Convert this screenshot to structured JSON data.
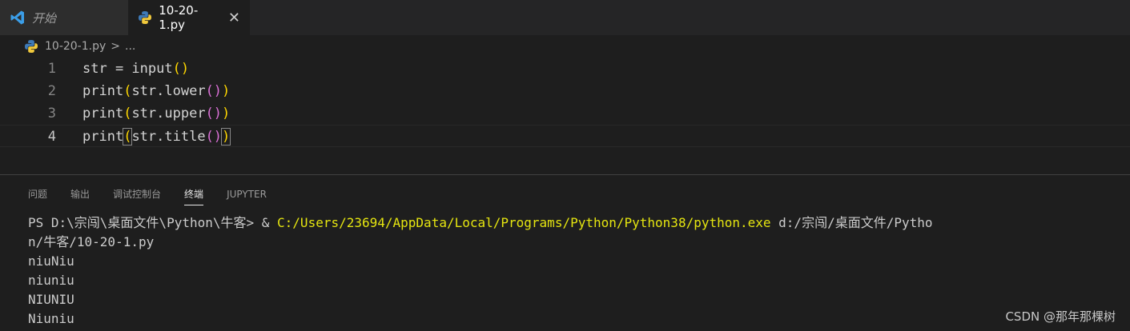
{
  "tabs": {
    "start_label": "开始",
    "file_label": "10-20-1.py",
    "close_glyph": "✕"
  },
  "breadcrumb": {
    "file": "10-20-1.py",
    "separator": ">",
    "more": "..."
  },
  "editor": {
    "lines": [
      {
        "num": "1",
        "a": "str = input",
        "o1": "(",
        "c1": ")"
      },
      {
        "num": "2",
        "a": "print",
        "o1": "(",
        "mid": "str.lower",
        "o2": "()",
        "c1": ")"
      },
      {
        "num": "3",
        "a": "print",
        "o1": "(",
        "mid": "str.upper",
        "o2": "()",
        "c1": ")"
      },
      {
        "num": "4",
        "a": "print",
        "o1": "(",
        "mid": "str.title",
        "o2": "()",
        "c1": ")"
      }
    ]
  },
  "panel": {
    "tabs": [
      "问题",
      "输出",
      "调试控制台",
      "终端",
      "JUPYTER"
    ],
    "active_tab": "终端"
  },
  "terminal": {
    "prompt": "PS D:\\宗闯\\桌面文件\\Python\\牛客> & ",
    "exe": "C:/Users/23694/AppData/Local/Programs/Python/Python38/python.exe",
    "arg1": " d:/宗闯/桌面文件/Pytho",
    "arg2": "n/牛客/10-20-1.py",
    "outputs": [
      "niuNiu",
      "niuniu",
      "NIUNIU",
      "Niuniu"
    ]
  },
  "watermark": "CSDN @那年那棵树",
  "colors": {
    "accent_yellow": "#ffd700",
    "accent_purple": "#da70d6",
    "terminal_yellow": "#e5e510"
  }
}
